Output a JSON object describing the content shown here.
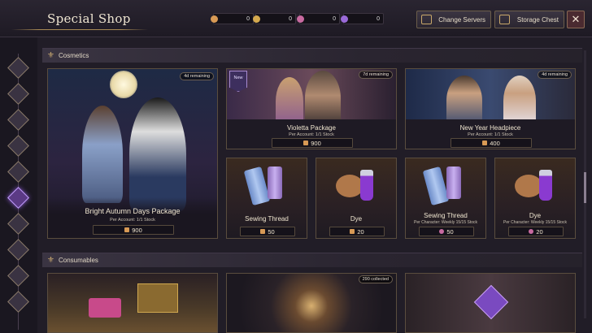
{
  "header": {
    "title": "Special Shop",
    "currencies": [
      {
        "icon": "arrow-currency-icon",
        "value": "0",
        "color": "#d89a55"
      },
      {
        "icon": "gold-coin-icon",
        "value": "0",
        "color": "#d4a94e"
      },
      {
        "icon": "pink-gem-icon",
        "value": "0",
        "color": "#c86aa0"
      },
      {
        "icon": "purple-gem-icon",
        "value": "0",
        "color": "#9a6ad8"
      }
    ],
    "change_servers_label": "Change Servers",
    "storage_chest_label": "Storage Chest",
    "close_label": "✕"
  },
  "sections": {
    "cosmetics": "Cosmetics",
    "consumables": "Consumables"
  },
  "cards": {
    "bright_autumn": {
      "badge": "4d remaining",
      "name": "Bright Autumn Days Package",
      "stock": "Per Account:   1/1 Stock",
      "price": "900"
    },
    "violetta": {
      "new": "New",
      "badge": "7d remaining",
      "name": "Violetta Package",
      "stock": "Per Account:   1/1 Stock",
      "price": "900"
    },
    "new_year": {
      "badge": "4d remaining",
      "name": "New Year Headpiece",
      "stock": "Per Account:   1/1 Stock",
      "price": "400"
    },
    "sewing_thread_1": {
      "name": "Sewing Thread",
      "stock": "",
      "price": "50"
    },
    "dye_1": {
      "name": "Dye",
      "stock": "",
      "price": "20"
    },
    "sewing_thread_2": {
      "name": "Sewing Thread",
      "stock": "Per Character:  Weekly 15/15 Stock",
      "price": "50"
    },
    "dye_2": {
      "name": "Dye",
      "stock": "Per Character:  Weekly 15/15 Stock",
      "price": "20"
    },
    "consumable_2": {
      "badge": "290 collected"
    }
  },
  "colors": {
    "accent_gold": "#c8a870",
    "active_tab": "#5b3a85",
    "arrow_price": "#d89a55",
    "gem_price": "#c86aa0"
  }
}
